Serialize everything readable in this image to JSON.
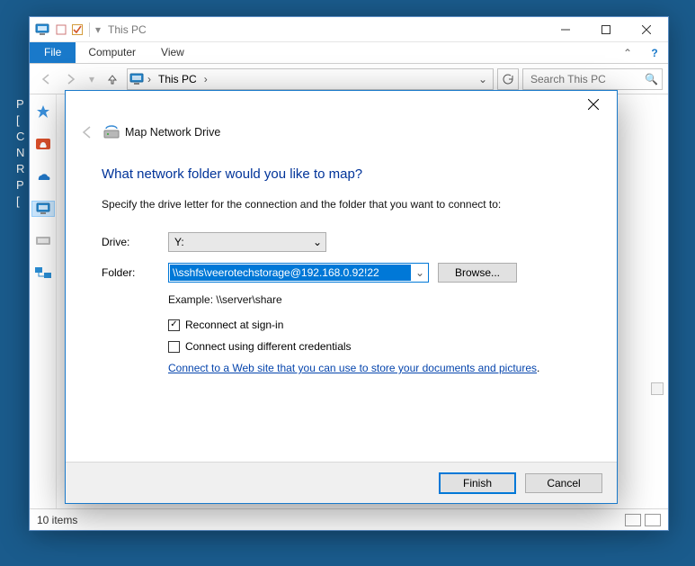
{
  "desktop_side_labels": [
    "P",
    "[",
    "C",
    "N",
    "R",
    "P",
    "["
  ],
  "explorer": {
    "title": "This PC",
    "ribbon": {
      "file": "File",
      "tabs": [
        "Computer",
        "View"
      ]
    },
    "breadcrumb": "This PC",
    "search_placeholder": "Search This PC",
    "status": "10 items"
  },
  "modal": {
    "title": "Map Network Drive",
    "heading": "What network folder would you like to map?",
    "subtext": "Specify the drive letter for the connection and the folder that you want to connect to:",
    "labels": {
      "drive": "Drive:",
      "folder": "Folder:"
    },
    "drive_value": "Y:",
    "folder_value": "\\\\sshfs\\veerotechstorage@192.168.0.92!22",
    "browse": "Browse...",
    "example": "Example: \\\\server\\share",
    "checkboxes": {
      "reconnect": {
        "label": "Reconnect at sign-in",
        "checked": true
      },
      "credentials": {
        "label": "Connect using different credentials",
        "checked": false
      }
    },
    "link": "Connect to a Web site that you can use to store your documents and pictures",
    "finish": "Finish",
    "cancel": "Cancel"
  }
}
